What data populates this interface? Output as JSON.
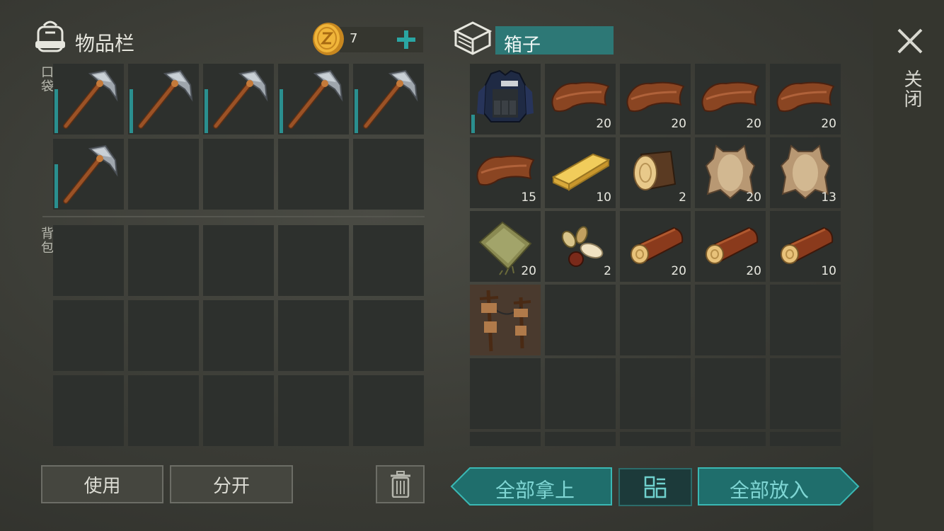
{
  "inventory": {
    "title": "物品栏",
    "coin_count": "7",
    "pocket_label": "口袋",
    "backpack_label": "背包"
  },
  "pocket_slots": [
    {
      "item": "pickaxe",
      "count": ""
    },
    {
      "item": "pickaxe",
      "count": ""
    },
    {
      "item": "pickaxe",
      "count": ""
    },
    {
      "item": "pickaxe",
      "count": ""
    },
    {
      "item": "pickaxe",
      "count": ""
    },
    {
      "item": "pickaxe",
      "count": ""
    },
    {
      "item": "",
      "count": ""
    },
    {
      "item": "",
      "count": ""
    },
    {
      "item": "",
      "count": ""
    },
    {
      "item": "",
      "count": ""
    }
  ],
  "box": {
    "title": "箱子"
  },
  "box_slots": [
    {
      "item": "police-vest",
      "count": ""
    },
    {
      "item": "leather",
      "count": "20"
    },
    {
      "item": "leather",
      "count": "20"
    },
    {
      "item": "leather",
      "count": "20"
    },
    {
      "item": "leather",
      "count": "20"
    },
    {
      "item": "leather",
      "count": "15"
    },
    {
      "item": "plank",
      "count": "10"
    },
    {
      "item": "log-stump",
      "count": "2"
    },
    {
      "item": "animal-hide",
      "count": "20"
    },
    {
      "item": "animal-hide",
      "count": "13"
    },
    {
      "item": "cloth",
      "count": "20"
    },
    {
      "item": "seeds",
      "count": "2"
    },
    {
      "item": "log",
      "count": "20"
    },
    {
      "item": "log",
      "count": "20"
    },
    {
      "item": "log",
      "count": "10"
    },
    {
      "item": "trap",
      "count": ""
    }
  ],
  "buttons": {
    "use": "使用",
    "split": "分开",
    "take_all": "全部拿上",
    "put_all": "全部放入",
    "close": "关闭"
  },
  "icons": {
    "backpack": "backpack-icon",
    "coin": "coin-icon",
    "add": "plus-icon",
    "box": "box-icon",
    "trash": "trash-icon",
    "sort": "sort-grid-icon",
    "close": "close-icon"
  },
  "colors": {
    "accent": "#2a8f8f",
    "teal_text": "#7fd6d4",
    "panel_bg": "#3b3c36",
    "slot_bg": "#2d302d"
  }
}
